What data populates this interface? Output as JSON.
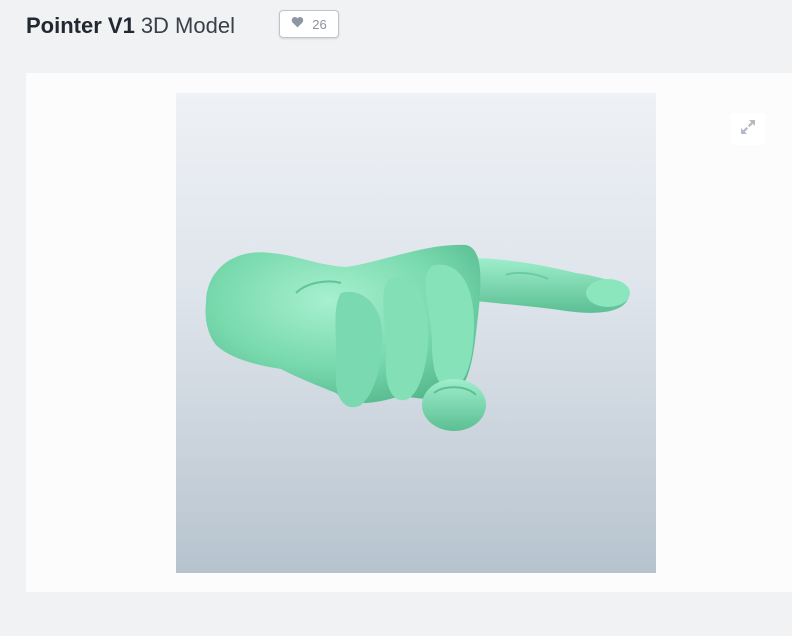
{
  "header": {
    "title_name": "Pointer V1",
    "title_suffix": "3D Model",
    "like_count": "26",
    "like_icon": "heart-icon"
  },
  "viewer": {
    "model_color": "#7fe0b4",
    "fullscreen_icon": "expand-arrows-icon"
  }
}
